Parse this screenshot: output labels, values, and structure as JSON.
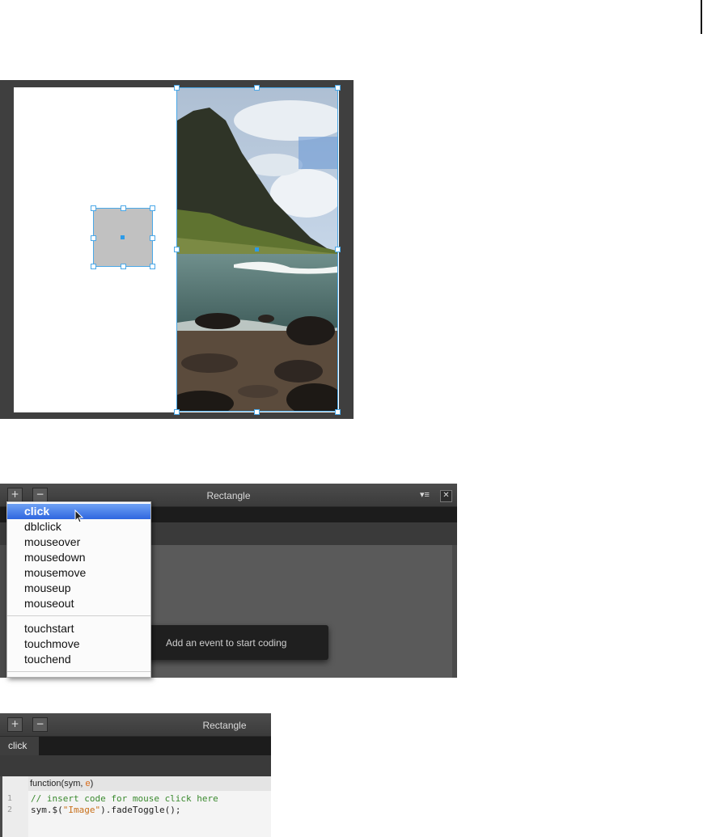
{
  "stage": {
    "description_free": true
  },
  "panel1": {
    "title": "Rectangle",
    "add_label": "+",
    "remove_label": "−",
    "close_label": "✕",
    "menu_glyph": "▾≡",
    "hint": "Add an event to start coding",
    "events_group1": [
      "click",
      "dblclick",
      "mouseover",
      "mousedown",
      "mousemove",
      "mouseup",
      "mouseout"
    ],
    "events_group2": [
      "touchstart",
      "touchmove",
      "touchend"
    ],
    "selected_event": "click"
  },
  "panel2": {
    "title": "Rectangle",
    "add_label": "+",
    "remove_label": "−",
    "tab": "click",
    "signature_prefix": "function(sym, ",
    "signature_param": "e",
    "signature_suffix": ")",
    "lines": [
      {
        "num": "1",
        "text": "// insert code for mouse click here"
      },
      {
        "num": "2",
        "sym": "sym.$(",
        "str": "\"Image\"",
        "rest": ").fadeToggle();"
      }
    ]
  },
  "colors": {
    "selection": "#4aa8e8",
    "menu_highlight": "#2f66df",
    "comment": "#3b8a2f"
  }
}
